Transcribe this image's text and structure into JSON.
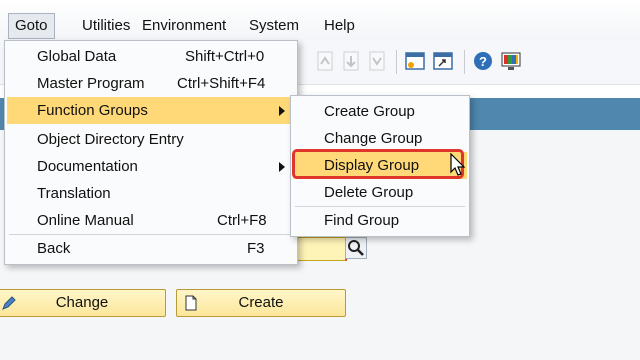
{
  "menubar": {
    "items": [
      {
        "label": "Goto",
        "active": true
      },
      {
        "label": "Utilities"
      },
      {
        "label": "Environment"
      },
      {
        "label": "System"
      },
      {
        "label": "Help"
      }
    ]
  },
  "goto_menu": {
    "items": [
      {
        "label": "Global Data",
        "shortcut": "Shift+Ctrl+0"
      },
      {
        "label": "Master Program",
        "shortcut": "Ctrl+Shift+F4"
      },
      {
        "label": "Function Groups",
        "submenu": true,
        "highlighted": true
      },
      {
        "label": "Object Directory Entry"
      },
      {
        "label": "Documentation",
        "submenu": true
      },
      {
        "label": "Translation"
      },
      {
        "label": "Online Manual",
        "shortcut": "Ctrl+F8"
      },
      {
        "label": "Back",
        "shortcut": "F3"
      }
    ]
  },
  "function_groups_submenu": {
    "items": [
      {
        "label": "Create Group"
      },
      {
        "label": "Change Group"
      },
      {
        "label": "Display Group",
        "highlighted": true
      },
      {
        "label": "Delete Group"
      },
      {
        "label": "Find Group"
      }
    ]
  },
  "buttons": {
    "change_label": "Change",
    "create_label": "Create"
  },
  "colors": {
    "highlight": "#ffd978",
    "band": "#4f87ae",
    "button": "#fbe79a",
    "focus_box": "#e0352b"
  }
}
